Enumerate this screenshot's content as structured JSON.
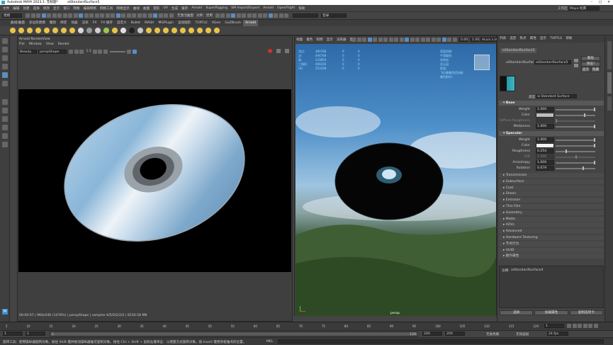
{
  "window": {
    "app_title": "Autodesk MAYA 2023.1: 无标题*",
    "tab_title": "aiStandardSurface5",
    "controls": {
      "minimize": "–",
      "maximize": "□",
      "close": "✕"
    }
  },
  "menubar": {
    "items": [
      "文件",
      "编辑",
      "创建",
      "选择",
      "修改",
      "显示",
      "窗口",
      "网格",
      "编辑网格",
      "网格工具",
      "网格显示",
      "曲线",
      "曲面",
      "变形",
      "UV",
      "生成",
      "缓存",
      "Arnold",
      "SuperRigging",
      "SM Import/Export",
      "Arnold",
      "OpenFlight",
      "帮助"
    ],
    "workspace_label": "工作区",
    "workspace_value": "Maya 经典"
  },
  "statusline": {
    "mode": "建模",
    "no_live_surface": "无激活曲面",
    "symmetry": "对称：禁用",
    "login": "登录"
  },
  "shelf": {
    "tabs": [
      "曲线/曲面",
      "多边形建模",
      "雕刻",
      "绑定",
      "动画",
      "渲染",
      "FX",
      "FX 缓存",
      "自定义",
      "Bullet",
      "MASH",
      "MGPlugin",
      "运动图形",
      "TURTLE",
      "XGen",
      "GoZBrush",
      "Arnold"
    ],
    "active_tab": "Arnold",
    "icon_colors": [
      "#e8c44a",
      "#e8c44a",
      "#e8c44a",
      "#e8c44a",
      "#e8c44a",
      "#e8c44a",
      "#e8c44a",
      "#e8c44a",
      "#d8d8d8",
      "#9a9a9a",
      "#d0d0d0",
      "#9ac84a",
      "#e8c44a",
      "#e0e0e0",
      "#202020",
      "#c8c8c8",
      "#e8c44a",
      "#e8c44a",
      "#e8c44a",
      "#e8c44a",
      "#e8c44a",
      "#e8c44a",
      "#e8c44a",
      "#e8c44a",
      "#e8c44a"
    ]
  },
  "renderview": {
    "title": "Arnold RenderView",
    "menu": [
      "File",
      "Window",
      "View",
      "Render"
    ],
    "status_select": "Beauty",
    "camera_select": "perspShape",
    "zoom": "1:1",
    "status_bar": "00:00:07 | 960x540 (1476%) | perspShape | samples 6/5/5/2/2/2 | 8150.58 MB"
  },
  "viewport": {
    "menu": [
      "视图",
      "着色",
      "照明",
      "显示",
      "渲染器",
      "面板"
    ],
    "gamma": "0.00",
    "exposure": "1.00",
    "colorspace": "ACES 1.0 SDR-video",
    "camera_label": "persp",
    "hud_left": [
      {
        "label": "顶点:",
        "a": "480788",
        "b": "0",
        "c": "0"
      },
      {
        "label": "边:",
        "a": "494768",
        "b": "0",
        "c": "0"
      },
      {
        "label": "面:",
        "a": "233850",
        "b": "0",
        "c": "0"
      },
      {
        "label": "三角形:",
        "a": "466160",
        "b": "0",
        "c": "0"
      },
      {
        "label": "UV:",
        "a": "253198",
        "b": "0",
        "c": "0"
      }
    ],
    "hud_right": [
      "背面消隐:",
      "平滑级别:",
      "实例化:",
      "显示层:",
      "距离:",
      "飞行器着色优先级:",
      "着色前(t):"
    ],
    "hud_right_values": [
      "",
      "",
      "",
      "",
      "",
      "",
      ""
    ]
  },
  "attribute_editor": {
    "menu": [
      "列表",
      "选定",
      "焦点",
      "属性",
      "显示",
      "TURTLE",
      "帮助"
    ],
    "node_tab": "aiStandardSurface5",
    "type_label": "aiStandardSurface:",
    "node_name": "aiStandardSurface5",
    "focus_btn": "聚焦",
    "preset_btn": "预设*",
    "show_btn": "显示",
    "hide_btn": "隐藏",
    "material_label": "类型",
    "material_type": "ai Standard Surface",
    "base": {
      "header": "Base",
      "weight_label": "Weight",
      "weight": "1.000",
      "color_label": "Color",
      "color_swatch": "#bdbdbd",
      "diffuse_label": "Diffuse Roughness",
      "diffuse": "",
      "metalness_label": "Metalness",
      "metalness": "1.000"
    },
    "specular": {
      "header": "Specular",
      "weight_label": "Weight",
      "weight": "1.000",
      "color_label": "Color",
      "color_swatch": "#f2f2f2",
      "roughness_label": "Roughness",
      "roughness": "0.254",
      "ior_label": "IOR",
      "ior": "1.500",
      "anisotropy_label": "Anisotropy",
      "anisotropy": "1.000",
      "rotation_label": "Rotation",
      "rotation": "0.679"
    },
    "collapsed_sections": [
      "Transmission",
      "Subsurface",
      "Coat",
      "Sheen",
      "Emission",
      "Thin Film",
      "Geometry",
      "Matte",
      "AOVs",
      "Advanced",
      "Hardware Texturing",
      "节点行为",
      "UUID",
      "额外属性"
    ],
    "notes_label": "注释:",
    "notes_value": "aiStandardSurface4",
    "buttons": [
      "选择",
      "加载属性",
      "复制选项卡"
    ]
  },
  "timeline": {
    "ticks": [
      "5",
      "10",
      "15",
      "20",
      "25",
      "30",
      "35",
      "40",
      "45",
      "50",
      "55",
      "60",
      "65",
      "70",
      "75",
      "80",
      "85",
      "90",
      "95",
      "100",
      "105",
      "110",
      "115",
      "120"
    ],
    "current_frame": "1"
  },
  "range": {
    "start": "1",
    "inner_start": "1",
    "inner_end": "120",
    "end_a": "120",
    "end_b": "200",
    "end_c": "200",
    "char_set": "无角色集",
    "anim_layer": "无动画层",
    "fps": "24 fps"
  },
  "helpline": {
    "text": "旋转工具：使用操纵器旋转对象。按住 Shift 键并拖动操纵器轴可复制对象。按住 Ctrl + Shift + 鼠标左键单击：以增量方式旋转对象。按 Insert 键更改枢轴点的位置。",
    "mel_label": "MEL"
  }
}
